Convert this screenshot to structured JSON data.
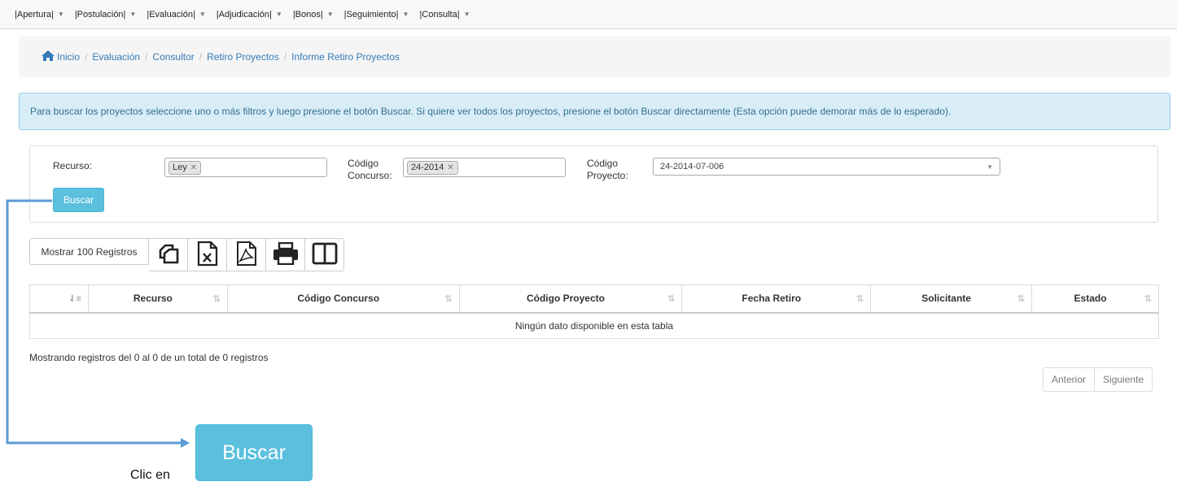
{
  "menu": [
    {
      "label": "|Apertura|"
    },
    {
      "label": "|Postulación|"
    },
    {
      "label": "|Evaluación|"
    },
    {
      "label": "|Adjudicación|"
    },
    {
      "label": "|Bonos|"
    },
    {
      "label": "|Seguimiento|"
    },
    {
      "label": "|Consulta|"
    }
  ],
  "breadcrumb": [
    "Inicio",
    "Evaluación",
    "Consultor",
    "Retiro Proyectos",
    "Informe Retiro Proyectos"
  ],
  "info_message": "Para buscar los proyectos seleccione uno o más filtros y luego presione el botón Buscar. Si quiere ver todos los proyectos, presione el botón Buscar directamente (Esta opción puede demorar más de lo esperado).",
  "filters": {
    "recurso_label": "Recurso:",
    "recurso_tag": "Ley",
    "concurso_label_1": "Código",
    "concurso_label_2": "Concurso:",
    "concurso_tag": "24-2014",
    "proyecto_label_1": "Código",
    "proyecto_label_2": "Proyecto:",
    "proyecto_value": "24-2014-07-006",
    "buscar_label": "Buscar"
  },
  "toolbar": {
    "show_label": "Mostrar 100 Registros",
    "icons": [
      "copy-icon",
      "excel-icon",
      "pdf-icon",
      "print-icon",
      "columns-icon"
    ]
  },
  "table": {
    "columns": [
      "",
      "Recurso",
      "Código Concurso",
      "Código Proyecto",
      "Fecha Retiro",
      "Solicitante",
      "Estado"
    ],
    "empty_message": "Ningún dato disponible en esta tabla"
  },
  "footer": {
    "info": "Mostrando registros del 0 al 0 de un total de 0 registros",
    "prev_label": "Anterior",
    "next_label": "Siguiente"
  },
  "annotation": {
    "button_label": "Buscar",
    "caption": "Clic en"
  },
  "colors": {
    "info_button": "#5bc0de",
    "link": "#337ab7",
    "connector": "#5b9bd5"
  }
}
